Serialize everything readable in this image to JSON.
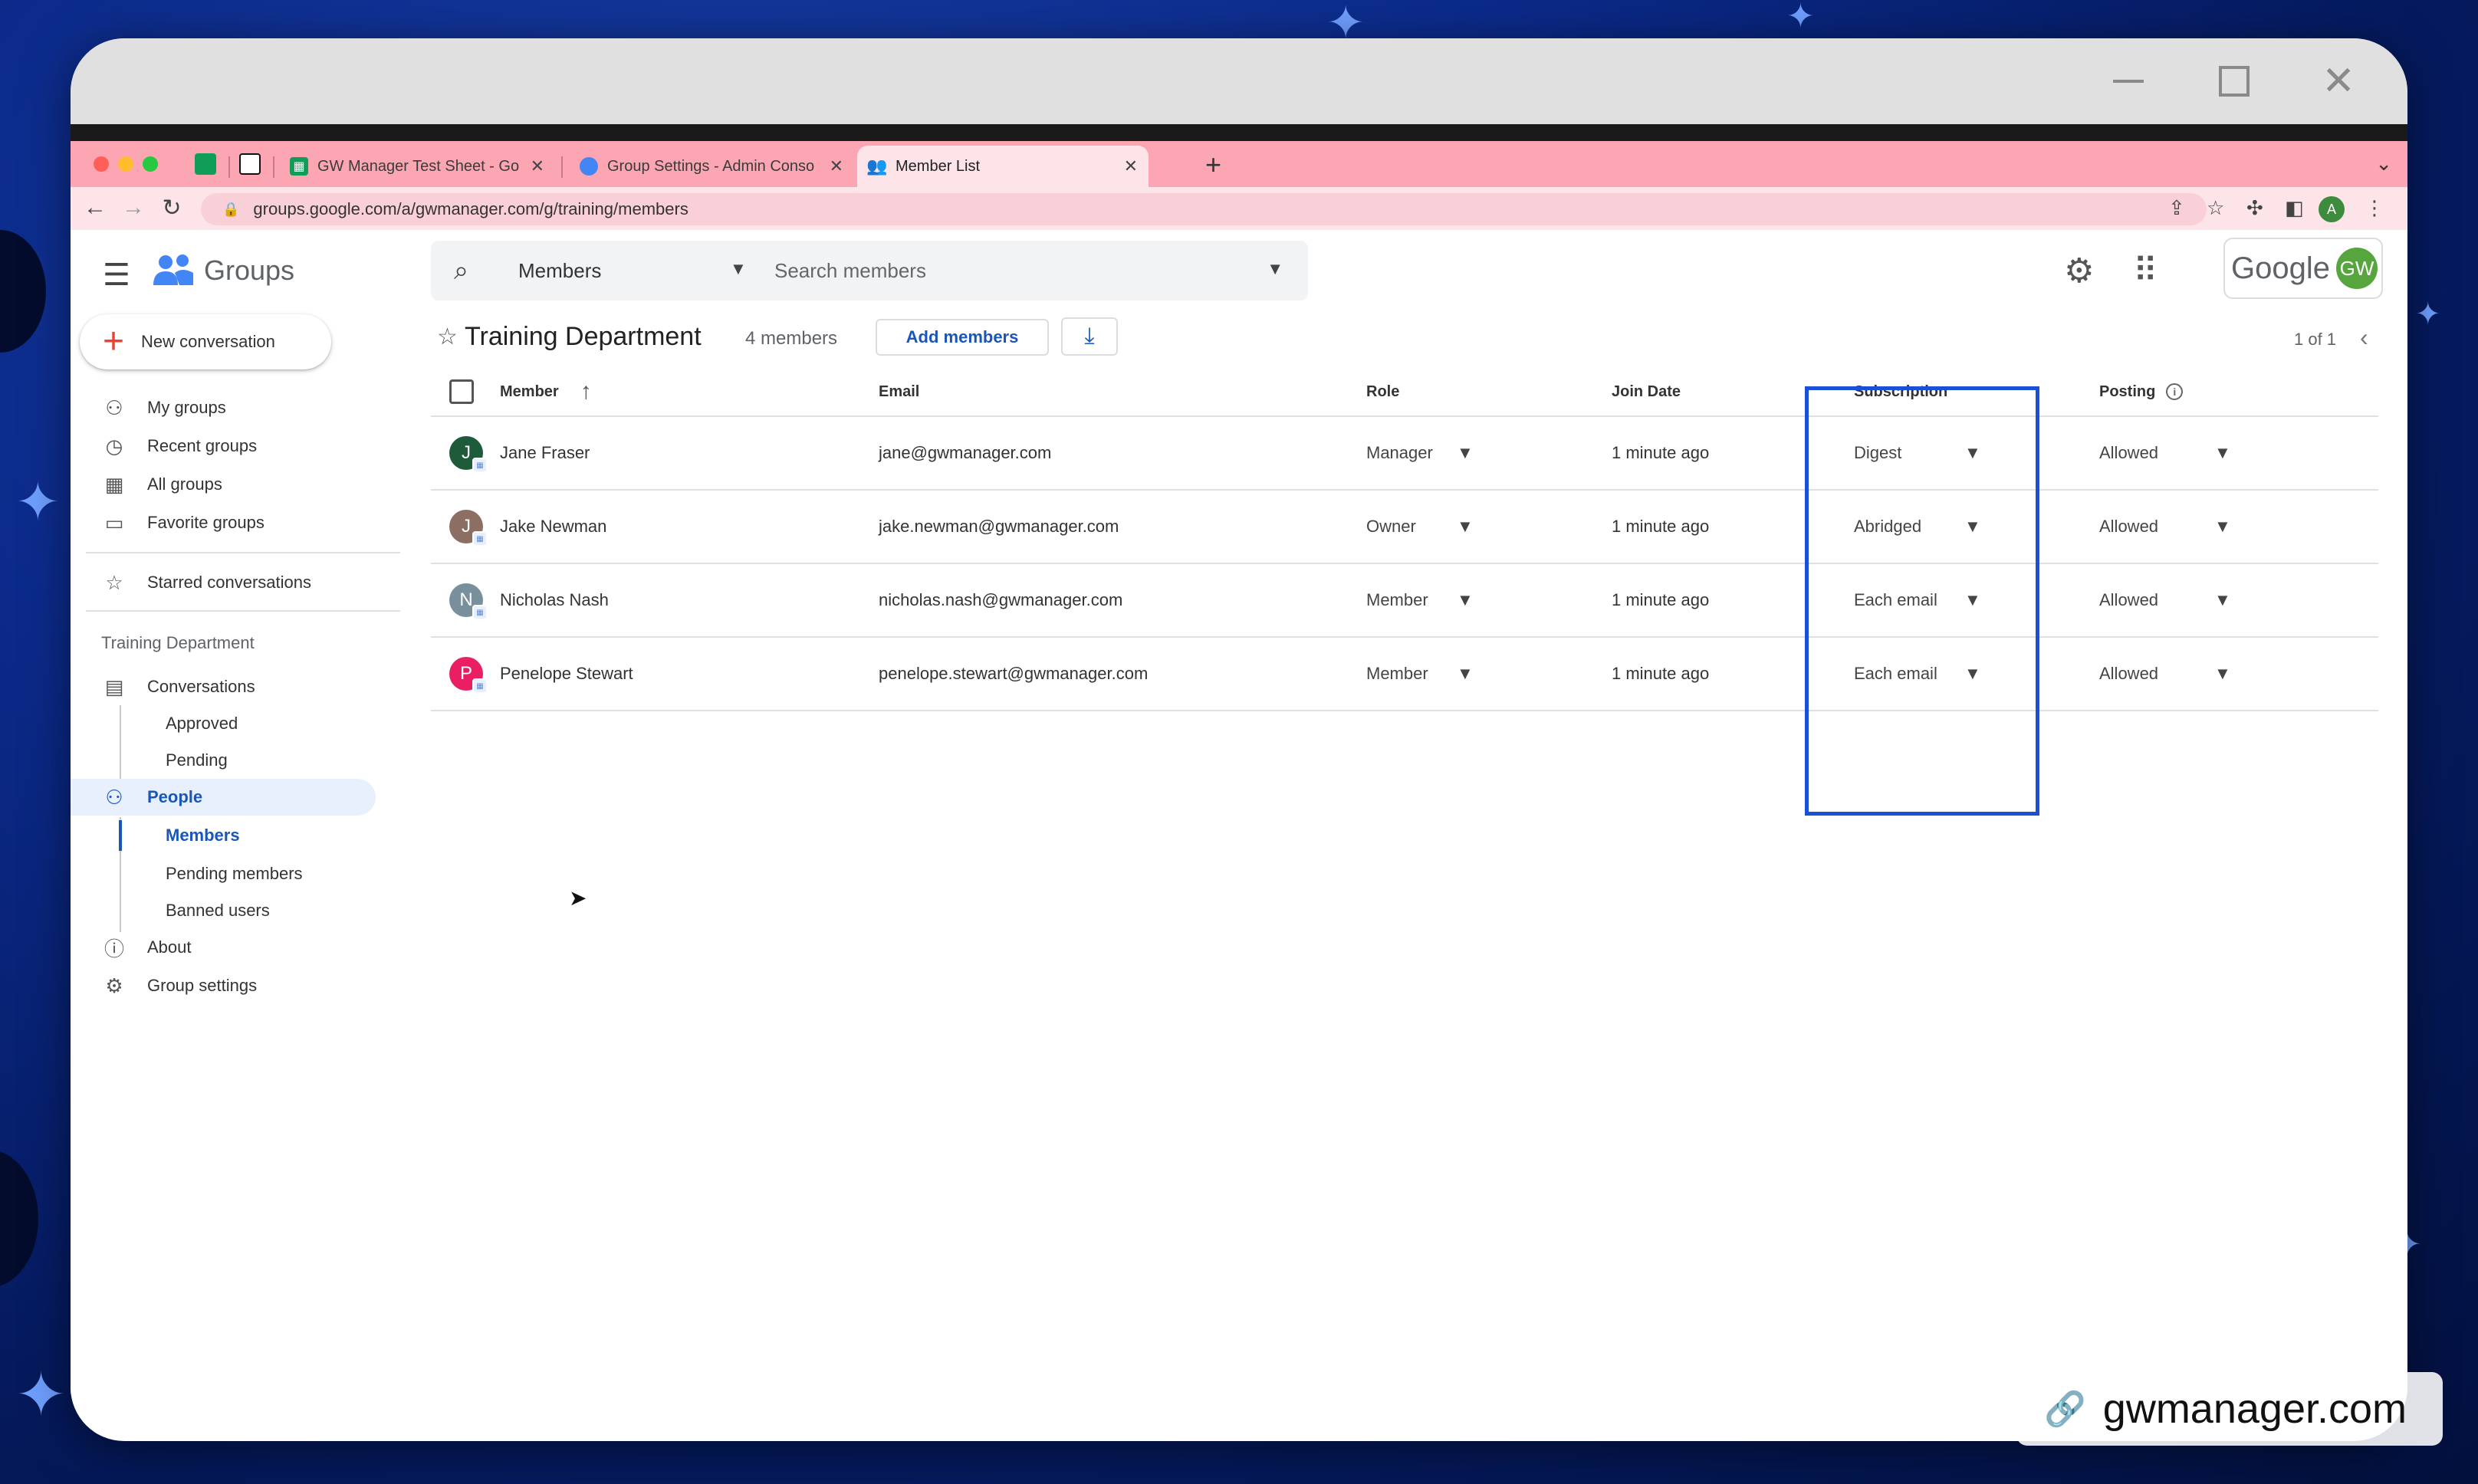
{
  "browser": {
    "tabs": [
      {
        "title": "GW Manager Test Sheet - Goo",
        "favicon_color": "#0f9d58"
      },
      {
        "title": "Group Settings - Admin Conso",
        "favicon_color": "#4285f4"
      },
      {
        "title": "Member List",
        "favicon_color": "#4285f4"
      }
    ],
    "url": "groups.google.com/a/gwmanager.com/g/training/members",
    "profile_initial": "A"
  },
  "app": {
    "name": "Groups",
    "search": {
      "scope": "Members",
      "placeholder": "Search members"
    },
    "account_word": "Google",
    "account_initials": "GW"
  },
  "sidebar": {
    "new_conversation": "New conversation",
    "items": [
      {
        "label": "My groups",
        "icon": "people-outline-icon"
      },
      {
        "label": "Recent groups",
        "icon": "clock-icon"
      },
      {
        "label": "All groups",
        "icon": "building-icon"
      },
      {
        "label": "Favorite groups",
        "icon": "folder-star-icon"
      }
    ],
    "starred": "Starred conversations",
    "group_heading": "Training Department",
    "conversations": "Conversations",
    "conv_sub": [
      "Approved",
      "Pending"
    ],
    "people": "People",
    "people_sub": [
      "Members",
      "Pending members",
      "Banned users"
    ],
    "about": "About",
    "group_settings": "Group settings"
  },
  "main": {
    "group_name": "Training Department",
    "member_count": "4 members",
    "add_members": "Add members",
    "pager": "1 of 1",
    "columns": {
      "member": "Member",
      "email": "Email",
      "role": "Role",
      "join_date": "Join Date",
      "subscription": "Subscription",
      "posting": "Posting"
    },
    "rows": [
      {
        "initial": "J",
        "avatar_color": "#1e5b3a",
        "name": "Jane Fraser",
        "email": "jane@gwmanager.com",
        "role": "Manager",
        "join": "1 minute ago",
        "subscription": "Digest",
        "posting": "Allowed"
      },
      {
        "initial": "J",
        "avatar_color": "#8d6e63",
        "name": "Jake Newman",
        "email": "jake.newman@gwmanager.com",
        "role": "Owner",
        "join": "1 minute ago",
        "subscription": "Abridged",
        "posting": "Allowed"
      },
      {
        "initial": "N",
        "avatar_color": "#78909c",
        "name": "Nicholas Nash",
        "email": "nicholas.nash@gwmanager.com",
        "role": "Member",
        "join": "1 minute ago",
        "subscription": "Each email",
        "posting": "Allowed"
      },
      {
        "initial": "P",
        "avatar_color": "#e91e63",
        "name": "Penelope Stewart",
        "email": "penelope.stewart@gwmanager.com",
        "role": "Member",
        "join": "1 minute ago",
        "subscription": "Each email",
        "posting": "Allowed"
      }
    ]
  },
  "watermark": "gwmanager.com"
}
